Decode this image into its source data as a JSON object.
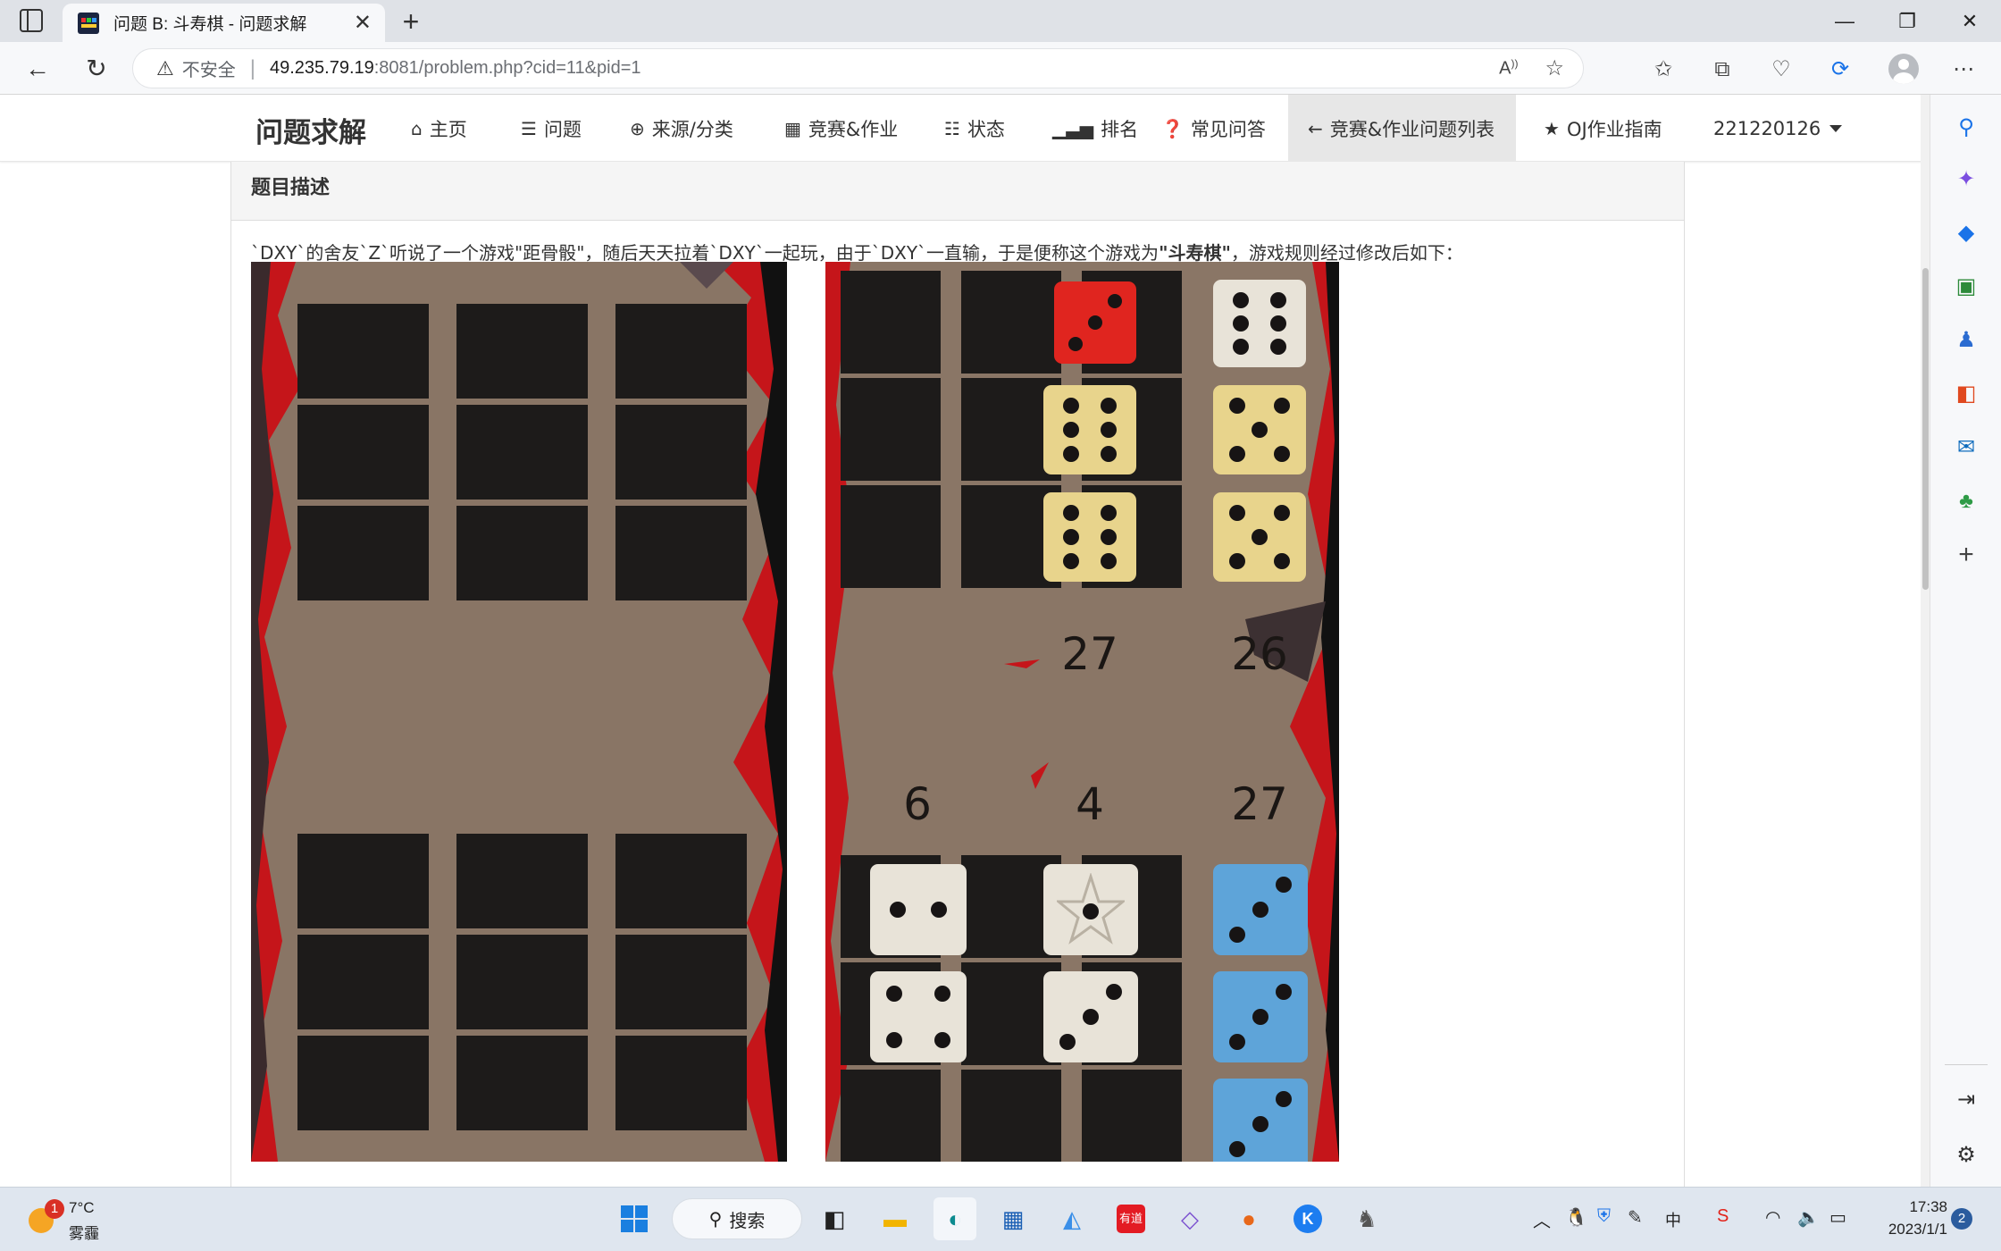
{
  "browser": {
    "tab_title": "问题 B: 斗寿棋 - 问题求解",
    "tab_close": "✕",
    "new_tab": "+",
    "url_warning": "不安全",
    "url_host": "49.235.79.19",
    "url_path": ":8081/problem.php?cid=11&pid=1"
  },
  "site_nav": {
    "brand": "问题求解",
    "items": [
      {
        "icon": "home-icon",
        "label": "主页"
      },
      {
        "icon": "list-icon",
        "label": "问题"
      },
      {
        "icon": "globe-icon",
        "label": "来源/分类"
      },
      {
        "icon": "calendar-icon",
        "label": "竞赛&作业"
      },
      {
        "icon": "checklist-icon",
        "label": "状态"
      },
      {
        "icon": "signal-icon",
        "label": "排名"
      },
      {
        "icon": "question-icon",
        "label": "常见问答"
      },
      {
        "icon": "arrow-left-icon",
        "label": "竞赛&作业问题列表"
      },
      {
        "icon": "star-icon",
        "label": "OJ作业指南"
      }
    ],
    "user": "221220126"
  },
  "problem": {
    "section_title": "题目描述",
    "desc_part1": "`DXY`的舍友`Z`听说了一个游戏\"距骨骰\"，随后天天拉着`DXY`一起玩，由于`DXY`一直输，于是便称这个游戏为",
    "desc_bold": "\"斗寿棋\"",
    "desc_part2": "，游戏规则经过修改后如下："
  },
  "game_image_2": {
    "top_scores": [
      "27",
      "26"
    ],
    "bottom_scores": [
      "6",
      "4",
      "27"
    ]
  },
  "taskbar": {
    "weather_temp": "7°C",
    "weather_desc": "雾霾",
    "weather_badge": "1",
    "search_label": "搜索",
    "youdao_label": "有道",
    "ime_label": "中",
    "time": "17:38",
    "date": "2023/1/1",
    "notify_count": "2"
  }
}
